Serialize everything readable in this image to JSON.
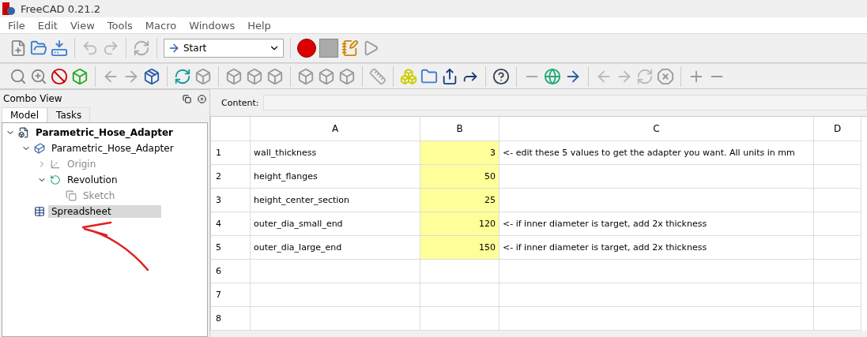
{
  "window": {
    "title": "FreeCAD 0.21.2"
  },
  "menu": [
    "File",
    "Edit",
    "View",
    "Tools",
    "Macro",
    "Windows",
    "Help"
  ],
  "toolbar": {
    "workbench": "Start"
  },
  "combo_view": {
    "title": "Combo View",
    "tabs": [
      {
        "label": "Model",
        "selected": true
      },
      {
        "label": "Tasks",
        "selected": false
      }
    ],
    "tree": [
      {
        "label": "Parametric_Hose_Adapter",
        "kind": "document",
        "expanded": true,
        "disabled": false,
        "selected": false,
        "children": [
          {
            "label": "Parametric_Hose_Adapter",
            "kind": "body",
            "expanded": true,
            "disabled": false,
            "selected": false,
            "children": [
              {
                "label": "Origin",
                "kind": "origin",
                "expanded": false,
                "disabled": true,
                "selected": false
              },
              {
                "label": "Revolution",
                "kind": "revolution",
                "expanded": true,
                "disabled": false,
                "selected": false,
                "children": [
                  {
                    "label": "Sketch",
                    "kind": "sketch",
                    "disabled": true,
                    "selected": false
                  }
                ]
              }
            ]
          },
          {
            "label": "Spreadsheet",
            "kind": "spreadsheet",
            "disabled": false,
            "selected": true
          }
        ]
      }
    ]
  },
  "spreadsheet": {
    "content_label": "Content:",
    "columns": [
      "A",
      "B",
      "C",
      "D"
    ],
    "rows": [
      {
        "number": "1",
        "a": "wall_thickness",
        "b": "3",
        "c": "<- edit these 5 values to get the adapter you want. All units in mm",
        "highlighted": true
      },
      {
        "number": "2",
        "a": "height_flanges",
        "b": "50",
        "highlighted": true
      },
      {
        "number": "3",
        "a": "height_center_section",
        "b": "25",
        "highlighted": true
      },
      {
        "number": "4",
        "a": "outer_dia_small_end",
        "b": "120",
        "c": "<- if inner diameter is target, add 2x thickness",
        "highlighted": true
      },
      {
        "number": "5",
        "a": "outer_dia_large_end",
        "b": "150",
        "c": "<- if inner diameter is target, add 2x thickness",
        "highlighted": true
      },
      {
        "number": "6",
        "highlighted": false
      },
      {
        "number": "7",
        "highlighted": false
      },
      {
        "number": "8",
        "highlighted": false
      }
    ]
  }
}
